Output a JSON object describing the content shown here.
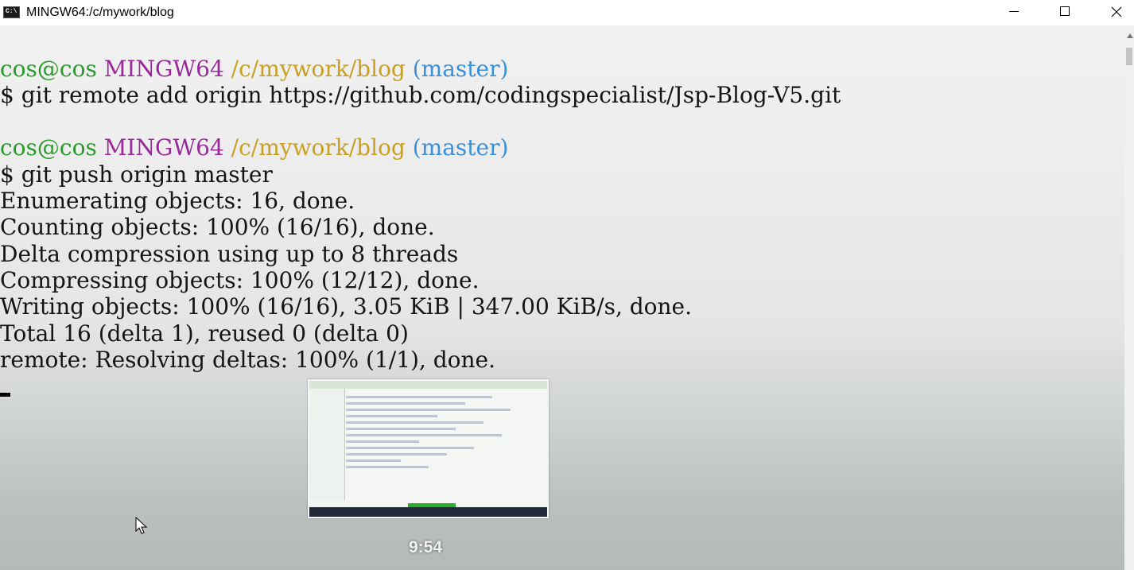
{
  "window": {
    "icon_text": "C:\\",
    "title": "MINGW64:/c/mywork/blog",
    "controls": [
      "minimize-icon",
      "maximize-icon",
      "close-icon"
    ]
  },
  "terminal": {
    "colors": {
      "user": "#2a9a2a",
      "host": "#9a2a9a",
      "path": "#c9a022",
      "branch": "#3a90d8",
      "text": "#141414"
    },
    "prompt1": {
      "user": "cos@cos",
      "host": "MINGW64",
      "path": "/c/mywork/blog",
      "branch": "(master)"
    },
    "cmd1": "$ git remote add origin https://github.com/codingspecialist/Jsp-Blog-V5.git",
    "prompt2": {
      "user": "cos@cos",
      "host": "MINGW64",
      "path": "/c/mywork/blog",
      "branch": "(master)"
    },
    "cmd2": "$ git push origin master",
    "output": [
      "Enumerating objects: 16, done.",
      "Counting objects: 100% (16/16), done.",
      "Delta compression using up to 8 threads",
      "Compressing objects: 100% (12/12), done.",
      "Writing objects: 100% (16/16), 3.05 KiB | 347.00 KiB/s, done.",
      "Total 16 (delta 1), reused 0 (delta 0)",
      "remote: Resolving deltas: 100% (1/1), done."
    ]
  },
  "preview": {
    "timestamp": "9:54"
  }
}
